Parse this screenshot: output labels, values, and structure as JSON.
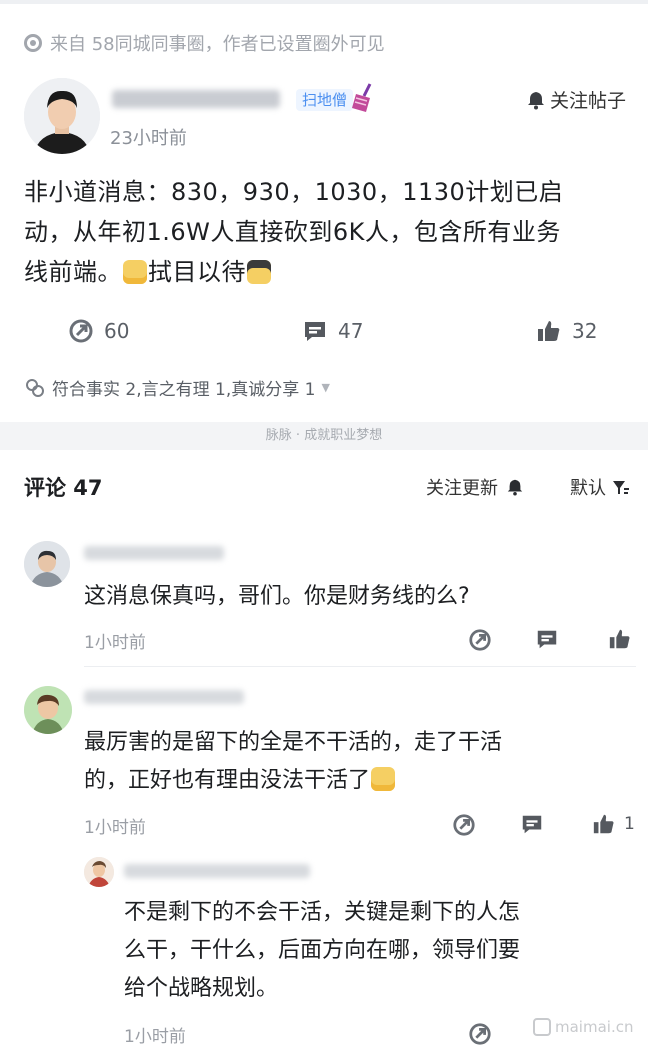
{
  "post": {
    "source": "来自 58同城同事圈，作者已设置圈外可见",
    "tag": "扫地僧",
    "follow_post": "关注帖子",
    "time": "23小时前",
    "body_line1": "非小道消息：830，930，1030，1130计划已启",
    "body_line2": "动，从年初1.6W人直接砍到6K人，包含所有业务",
    "body_line3_a": "线前端。",
    "body_line3_b": "拭目以待",
    "actions": {
      "share_count": "60",
      "comment_count": "47",
      "like_count": "32"
    },
    "reactions": "符合事实 2,言之有理 1,真诚分享 1"
  },
  "slogan": "脉脉 · 成就职业梦想",
  "comments_header": {
    "title": "评论 47",
    "follow_updates": "关注更新",
    "sort": "默认"
  },
  "comments": [
    {
      "text": "这消息保真吗，哥们。你是财务线的么?",
      "time": "1小时前",
      "likes": ""
    },
    {
      "line1": "最厉害的是留下的全是不干活的，走了干活",
      "line2": "的，正好也有理由没法干活了",
      "time": "1小时前",
      "likes": "1"
    }
  ],
  "reply": {
    "line1": "不是剩下的不会干活，关键是剩下的人怎",
    "line2": "么干，干什么，后面方向在哪，领导们要",
    "line3": "给个战略规划。",
    "time": "1小时前"
  },
  "watermark": "maimai.cn",
  "colors": {
    "accent_blue": "#4b8ff0",
    "muted_gray": "#9a9ea5",
    "divider": "#f3f4f6"
  },
  "icons": [
    "eye-icon",
    "broom-icon",
    "bell-icon",
    "share-icon",
    "comment-icon",
    "thumbs-up-icon",
    "reaction-icon",
    "filter-icon"
  ]
}
